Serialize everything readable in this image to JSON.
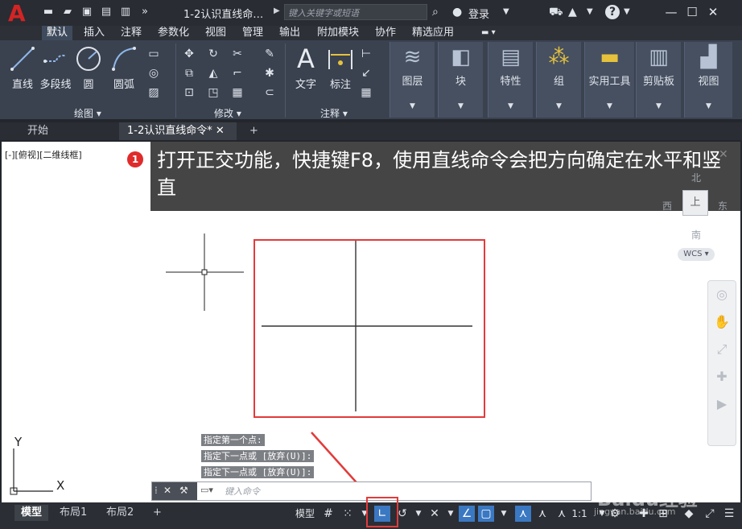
{
  "app": {
    "logo": "A",
    "doc_title": "1-2认识直线命…",
    "search_placeholder": "键入关键字或短语",
    "login": "登录",
    "help": "?"
  },
  "ribbon_tabs": [
    "默认",
    "插入",
    "注释",
    "参数化",
    "视图",
    "管理",
    "输出",
    "附加模块",
    "协作",
    "精选应用"
  ],
  "ribbon": {
    "draw": {
      "label": "绘图",
      "tools": [
        "直线",
        "多段线",
        "圆",
        "圆弧"
      ]
    },
    "modify": {
      "label": "修改"
    },
    "annotation": {
      "label": "注释",
      "tools": [
        "文字",
        "标注"
      ]
    },
    "tiles": [
      "图层",
      "块",
      "特性",
      "组",
      "实用工具",
      "剪贴板",
      "视图"
    ]
  },
  "doc_tabs": {
    "home": "开始",
    "active": "1-2认识直线命令*"
  },
  "viewport": {
    "label": "[-][俯视][二维线框]"
  },
  "hint": {
    "number": "1",
    "text": "打开正交功能，快捷键F8，使用直线命令会把方向确定在水平和竖直"
  },
  "viewcube": {
    "north": "北",
    "south": "南",
    "east": "东",
    "west": "西",
    "top": "上",
    "wcs": "WCS"
  },
  "ucs": {
    "x": "X",
    "y": "Y"
  },
  "command_history": [
    "指定第一个点:",
    "指定下一点或 [放弃(U)]:",
    "指定下一点或 [放弃(U)]:"
  ],
  "command_placeholder": "键入命令",
  "layout_tabs": [
    "模型",
    "布局1",
    "布局2"
  ],
  "status": {
    "model": "模型",
    "scale": "1:1",
    "ortho_on": true
  },
  "watermark": {
    "brand": "Baidu经验",
    "url": "jingyan.baidu.com"
  },
  "colors": {
    "accent_red": "#e23b3b",
    "ribbon": "#3a4250",
    "status_on": "#3b78c2"
  }
}
